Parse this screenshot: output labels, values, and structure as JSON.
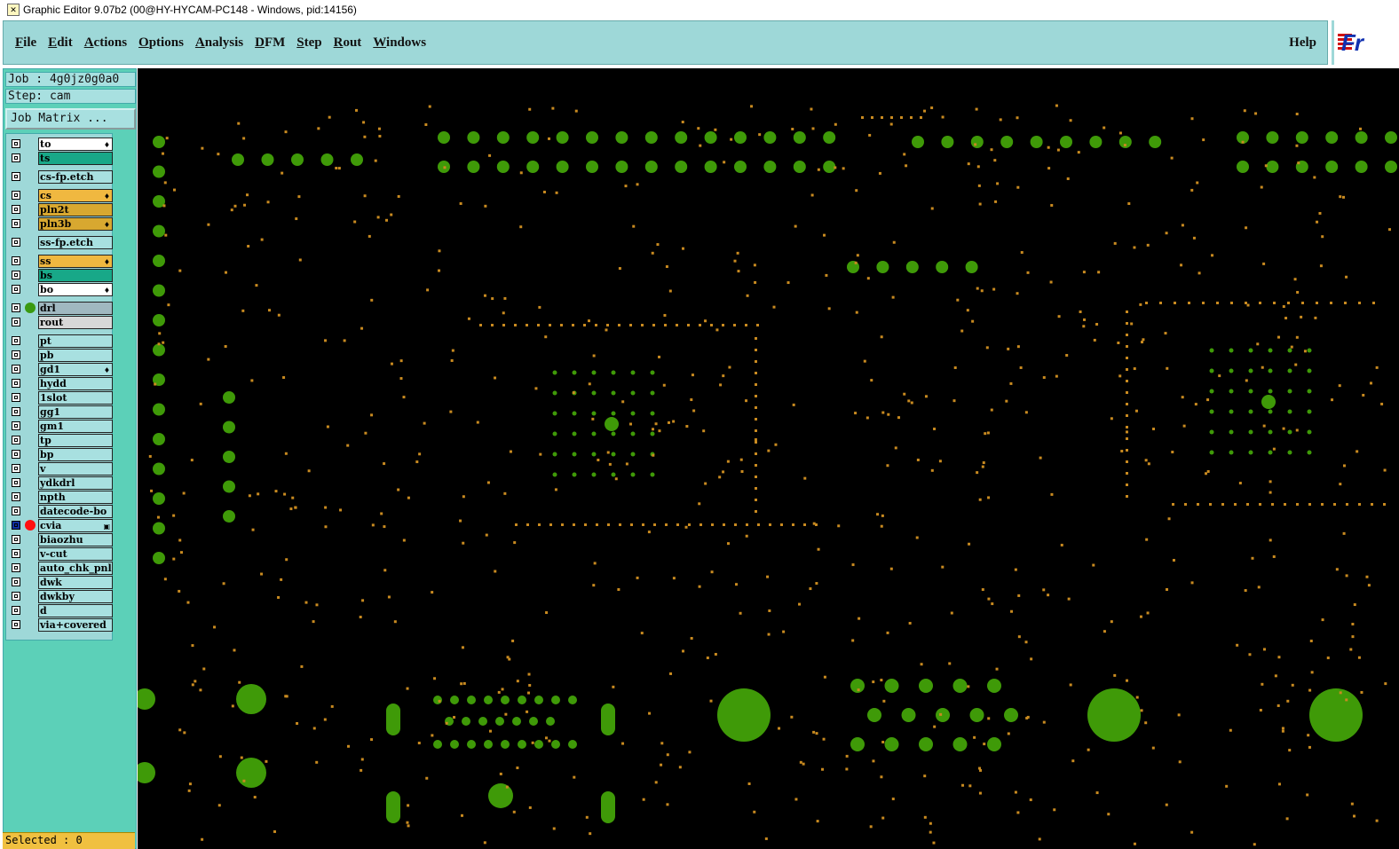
{
  "window": {
    "title": "Graphic Editor 9.07b2 (00@HY-HYCAM-PC148 - Windows, pid:14156)"
  },
  "menu": {
    "items": [
      "File",
      "Edit",
      "Actions",
      "Options",
      "Analysis",
      "DFM",
      "Step",
      "Rout",
      "Windows"
    ],
    "help": "Help"
  },
  "logo": {
    "text": "Fr"
  },
  "job": {
    "label": "Job : 4g0jz0g0a0",
    "step": "Step: cam",
    "matrix_button": "Job Matrix ..."
  },
  "layers": [
    {
      "name": "to",
      "bg": "#ffffff",
      "flag": "♦"
    },
    {
      "name": "ts",
      "bg": "#18a888"
    },
    {
      "name": "cs-fp.etch",
      "bg": "#a8e0e0"
    },
    {
      "name": "cs",
      "bg": "#f0b840",
      "flag": "♦"
    },
    {
      "name": "pln2t",
      "bg": "#d8a830"
    },
    {
      "name": "pln3b",
      "bg": "#d8a830",
      "flag": "♦"
    },
    {
      "name": "ss-fp.etch",
      "bg": "#a8e0e0"
    },
    {
      "name": "ss",
      "bg": "#f0b840",
      "flag": "♦"
    },
    {
      "name": "bs",
      "bg": "#18a888"
    },
    {
      "name": "bo",
      "bg": "#ffffff",
      "flag": "♦"
    },
    {
      "name": "drl",
      "bg": "#a0b8c0",
      "dot": "#3a9a10"
    },
    {
      "name": "rout",
      "bg": "#d8d8d8"
    },
    {
      "name": "pt",
      "bg": "#a8e0e0"
    },
    {
      "name": "pb",
      "bg": "#a8e0e0"
    },
    {
      "name": "gd1",
      "bg": "#a8e0e0",
      "flag": "♦"
    },
    {
      "name": "hydd",
      "bg": "#a8e0e0"
    },
    {
      "name": "1slot",
      "bg": "#a8e0e0"
    },
    {
      "name": "gg1",
      "bg": "#a8e0e0"
    },
    {
      "name": "gm1",
      "bg": "#a8e0e0"
    },
    {
      "name": "tp",
      "bg": "#a8e0e0"
    },
    {
      "name": "bp",
      "bg": "#a8e0e0"
    },
    {
      "name": "v",
      "bg": "#a8e0e0"
    },
    {
      "name": "ydkdrl",
      "bg": "#a8e0e0"
    },
    {
      "name": "npth",
      "bg": "#a8e0e0"
    },
    {
      "name": "datecode-bo",
      "bg": "#a8e0e0"
    },
    {
      "name": "cvia",
      "bg": "#a8e0e0",
      "dot": "#ff1010",
      "flag": "▣",
      "active": true
    },
    {
      "name": "biaozhu",
      "bg": "#a8e0e0"
    },
    {
      "name": "v-cut",
      "bg": "#a8e0e0"
    },
    {
      "name": "auto_chk_pnl",
      "bg": "#a8e0e0"
    },
    {
      "name": "dwk",
      "bg": "#a8e0e0"
    },
    {
      "name": "dwkby",
      "bg": "#a8e0e0"
    },
    {
      "name": "d",
      "bg": "#a8e0e0"
    },
    {
      "name": "via+covered",
      "bg": "#a8e0e0"
    }
  ],
  "status": {
    "selected": "Selected : 0"
  },
  "colors": {
    "pad": "#3f9a08",
    "via": "#c88a20",
    "background": "#000000"
  }
}
